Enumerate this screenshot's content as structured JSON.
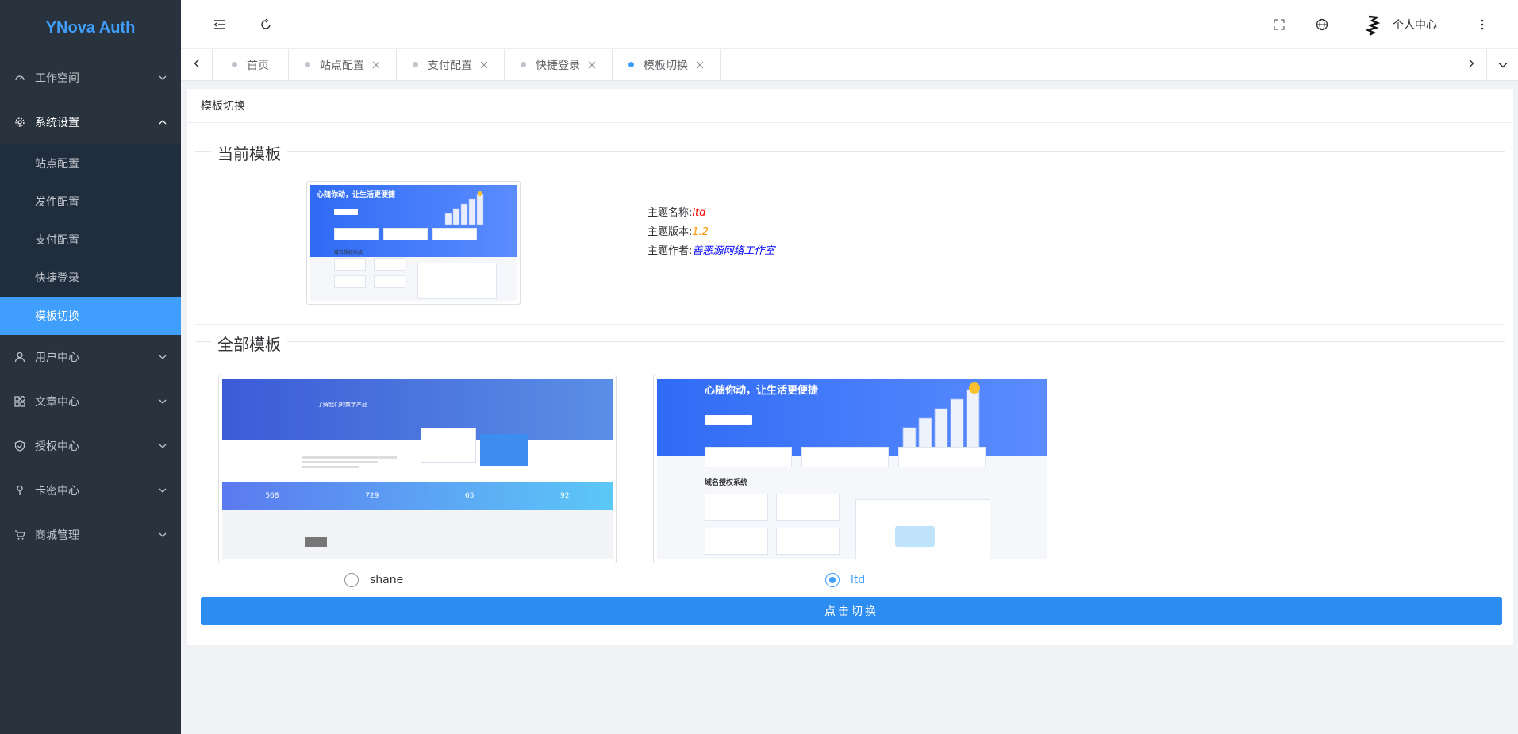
{
  "app": {
    "logo_text": "YNova Auth"
  },
  "sidebar": {
    "items": [
      {
        "label": "工作空间",
        "icon": "dashboard-icon",
        "expanded": false
      },
      {
        "label": "系统设置",
        "icon": "gear-icon",
        "expanded": true,
        "children": [
          {
            "label": "站点配置"
          },
          {
            "label": "发件配置"
          },
          {
            "label": "支付配置"
          },
          {
            "label": "快捷登录"
          },
          {
            "label": "模板切换",
            "active": true
          }
        ]
      },
      {
        "label": "用户中心",
        "icon": "user-icon",
        "expanded": false
      },
      {
        "label": "文章中心",
        "icon": "article-icon",
        "expanded": false
      },
      {
        "label": "授权中心",
        "icon": "shield-icon",
        "expanded": false
      },
      {
        "label": "卡密中心",
        "icon": "key-icon",
        "expanded": false
      },
      {
        "label": "商城管理",
        "icon": "cart-icon",
        "expanded": false
      }
    ]
  },
  "header": {
    "user_name": "个人中心"
  },
  "tabs": [
    {
      "label": "首页",
      "closable": false,
      "active": false
    },
    {
      "label": "站点配置",
      "closable": true,
      "active": false
    },
    {
      "label": "支付配置",
      "closable": true,
      "active": false
    },
    {
      "label": "快捷登录",
      "closable": true,
      "active": false
    },
    {
      "label": "模板切换",
      "closable": true,
      "active": true
    }
  ],
  "page": {
    "title": "模板切换",
    "current_section": "当前模板",
    "all_section": "全部模板",
    "current": {
      "name_label": "主题名称:",
      "name_value": "ltd",
      "version_label": "主题版本:",
      "version_value": "1.2",
      "author_label": "主题作者:",
      "author_value": "善恶源网络工作室",
      "preview_headline": "心随你动，让生活更便捷",
      "preview_section": "域名授权系统"
    },
    "templates": [
      {
        "name": "shane",
        "selected": false,
        "preview_headline": "了解我们的数字产品",
        "preview_stats": [
          "568",
          "729",
          "65",
          "92"
        ]
      },
      {
        "name": "ltd",
        "selected": true,
        "preview_headline": "心随你动，让生活更便捷",
        "preview_section": "域名授权系统"
      }
    ],
    "switch_button": "点击切换"
  },
  "colors": {
    "accent": "#409eff",
    "sidebar_bg": "#28333e",
    "button": "#2d8cf0"
  }
}
